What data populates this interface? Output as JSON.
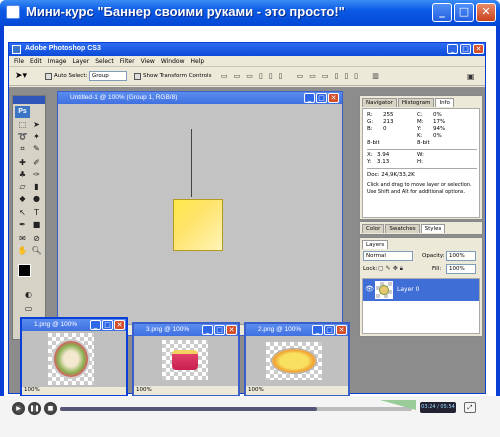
{
  "outer_window": {
    "title": "Мини-курс \"Баннер своими руками - это просто!\"",
    "minimize": "_",
    "maximize": "□",
    "close": "✕"
  },
  "photoshop": {
    "title": "Adobe Photoshop CS3",
    "menu": [
      "File",
      "Edit",
      "Image",
      "Layer",
      "Select",
      "Filter",
      "View",
      "Window",
      "Help"
    ],
    "options": {
      "auto_select_label": "Auto Select:",
      "auto_select_value": "Group",
      "show_transform_label": "Show Transform Controls"
    }
  },
  "document": {
    "title": "Untitled-1 @ 100% (Group 1, RGB/8)",
    "banner_color": "#ffe94a"
  },
  "navigator_panel": {
    "tabs": [
      "Navigator",
      "Histogram",
      "Info"
    ],
    "active_tab": "Info",
    "rows": [
      {
        "a": "R:",
        "av": "255",
        "b": "C:",
        "bv": "0%"
      },
      {
        "a": "G:",
        "av": "213",
        "b": "M:",
        "bv": "17%"
      },
      {
        "a": "B:",
        "av": "0",
        "b": "Y:",
        "bv": "94%"
      },
      {
        "a": "",
        "av": "",
        "b": "K:",
        "bv": "0%"
      },
      {
        "a": "8-bit",
        "av": "",
        "b": "8-bit",
        "bv": ""
      }
    ],
    "xy": {
      "x": "X:",
      "xv": "3.94",
      "y": "Y:",
      "yv": "3.13",
      "w": "W:",
      "h": "H:"
    },
    "doc": "Doc: 24,9K/33,2K",
    "hint": "Click and drag to move layer or selection. Use Shift and Alt for additional options."
  },
  "color_panel": {
    "tabs": [
      "Color",
      "Swatches",
      "Styles"
    ],
    "active_tab": "Styles"
  },
  "layers_panel": {
    "tabs": [
      "Layers"
    ],
    "mode": "Normal",
    "opacity_label": "Opacity:",
    "opacity_value": "100%",
    "lock_label": "Lock:",
    "fill_label": "Fill:",
    "fill_value": "100%",
    "layer_name": "Layer 0"
  },
  "image_windows": [
    {
      "title": "1.png @ 100%",
      "zoom": "100%"
    },
    {
      "title": "3.png @ 100%",
      "zoom": "100%"
    },
    {
      "title": "2.png @ 100%",
      "zoom": "100%"
    }
  ],
  "player": {
    "time": "03:24 / 05:54",
    "progress": 0.73
  },
  "colors": {
    "xp_title": "#0a5ae6",
    "ps_bg": "#ece9d8",
    "workspace": "#8c8c8c",
    "selected_layer": "#3f6fd6"
  }
}
